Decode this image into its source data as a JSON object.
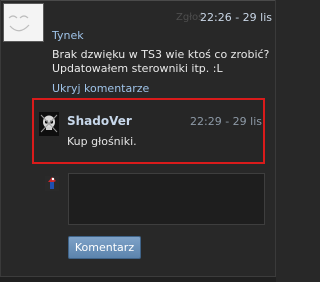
{
  "comment": {
    "author": "Tynek",
    "report_label": "Zgłoś",
    "time": "22:26 - 29 lis",
    "text": "Brak dzwięku w TS3 wie ktoś co zrobić? Updatowałem sterowniki itp. :L",
    "hide_link": "Ukryj komentarze"
  },
  "reply": {
    "author": "ShadoVer",
    "time": "22:29 - 29 lis",
    "text": "Kup głośniki."
  },
  "compose": {
    "input_value": "",
    "submit_label": "Komentarz"
  },
  "colors": {
    "highlight": "#d91b1b",
    "link": "#9fc3e8",
    "button": "#6d93ba"
  }
}
